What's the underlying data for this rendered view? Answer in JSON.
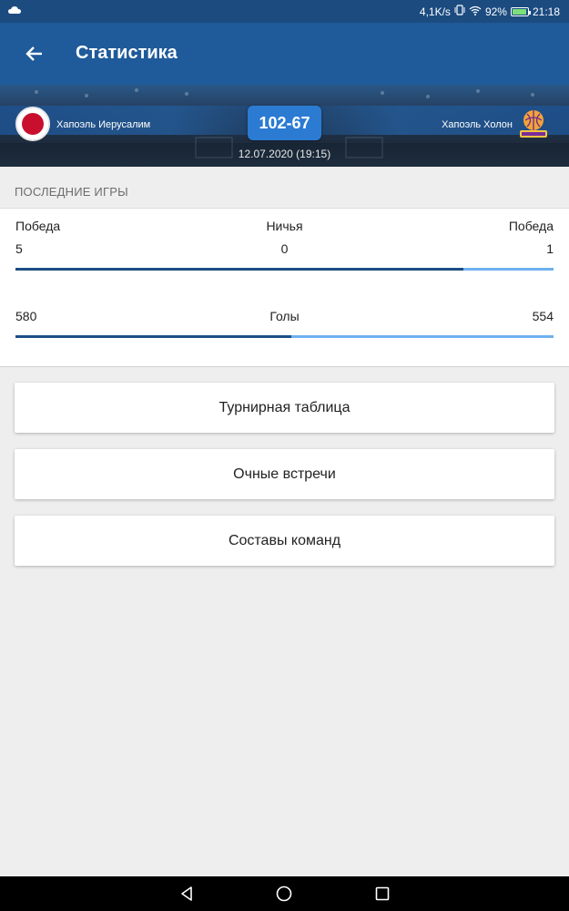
{
  "status_bar": {
    "net_speed": "4,1K/s",
    "battery_percent": "92%",
    "battery_level": 0.92,
    "time": "21:18"
  },
  "app_bar": {
    "title": "Статистика",
    "back_icon": "arrow-left-icon"
  },
  "match": {
    "home_team": "Хапоэль Иерусалим",
    "away_team": "Хапоэль Холон",
    "score": "102-67",
    "datetime": "12.07.2020 (19:15)"
  },
  "last_games": {
    "title": "ПОСЛЕДНИЕ ИГРЫ",
    "results": {
      "home_label": "Победа",
      "draw_label": "Ничья",
      "away_label": "Победа",
      "home_value": "5",
      "draw_value": "0",
      "away_value": "1",
      "home_share": 0.833
    },
    "goals": {
      "label": "Голы",
      "home_value": "580",
      "away_value": "554",
      "home_share": 0.512
    }
  },
  "nav_cards": [
    {
      "label": "Турнирная таблица"
    },
    {
      "label": "Очные встречи"
    },
    {
      "label": "Составы команд"
    }
  ],
  "system_nav": {
    "back_icon": "triangle-back-icon",
    "home_icon": "circle-home-icon",
    "recents_icon": "square-recents-icon"
  },
  "colors": {
    "app_bar": "#1f5a9a",
    "score_badge": "#2b7bd3",
    "bar_dark": "#1d4e86",
    "bar_light": "#6fb0f0"
  }
}
